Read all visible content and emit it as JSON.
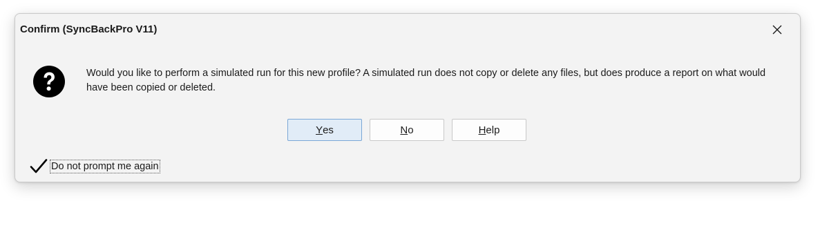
{
  "dialog": {
    "title": "Confirm (SyncBackPro V11)",
    "close_icon": "close-icon",
    "icon": "question-icon",
    "message": "Would you like to perform a simulated run for this new profile? A simulated run does not copy or delete any files, but does produce a report on what would have been copied or deleted.",
    "buttons": {
      "yes": {
        "mnemonic": "Y",
        "rest": "es"
      },
      "no": {
        "mnemonic": "N",
        "rest": "o"
      },
      "help": {
        "mnemonic": "H",
        "rest": "elp"
      }
    },
    "checkbox": {
      "label": "Do not prompt me again",
      "checked": true
    }
  },
  "colors": {
    "dialog_bg": "#f3f3f3",
    "default_button_bg": "#e1ecf7",
    "default_button_border": "#7aa7d6"
  }
}
